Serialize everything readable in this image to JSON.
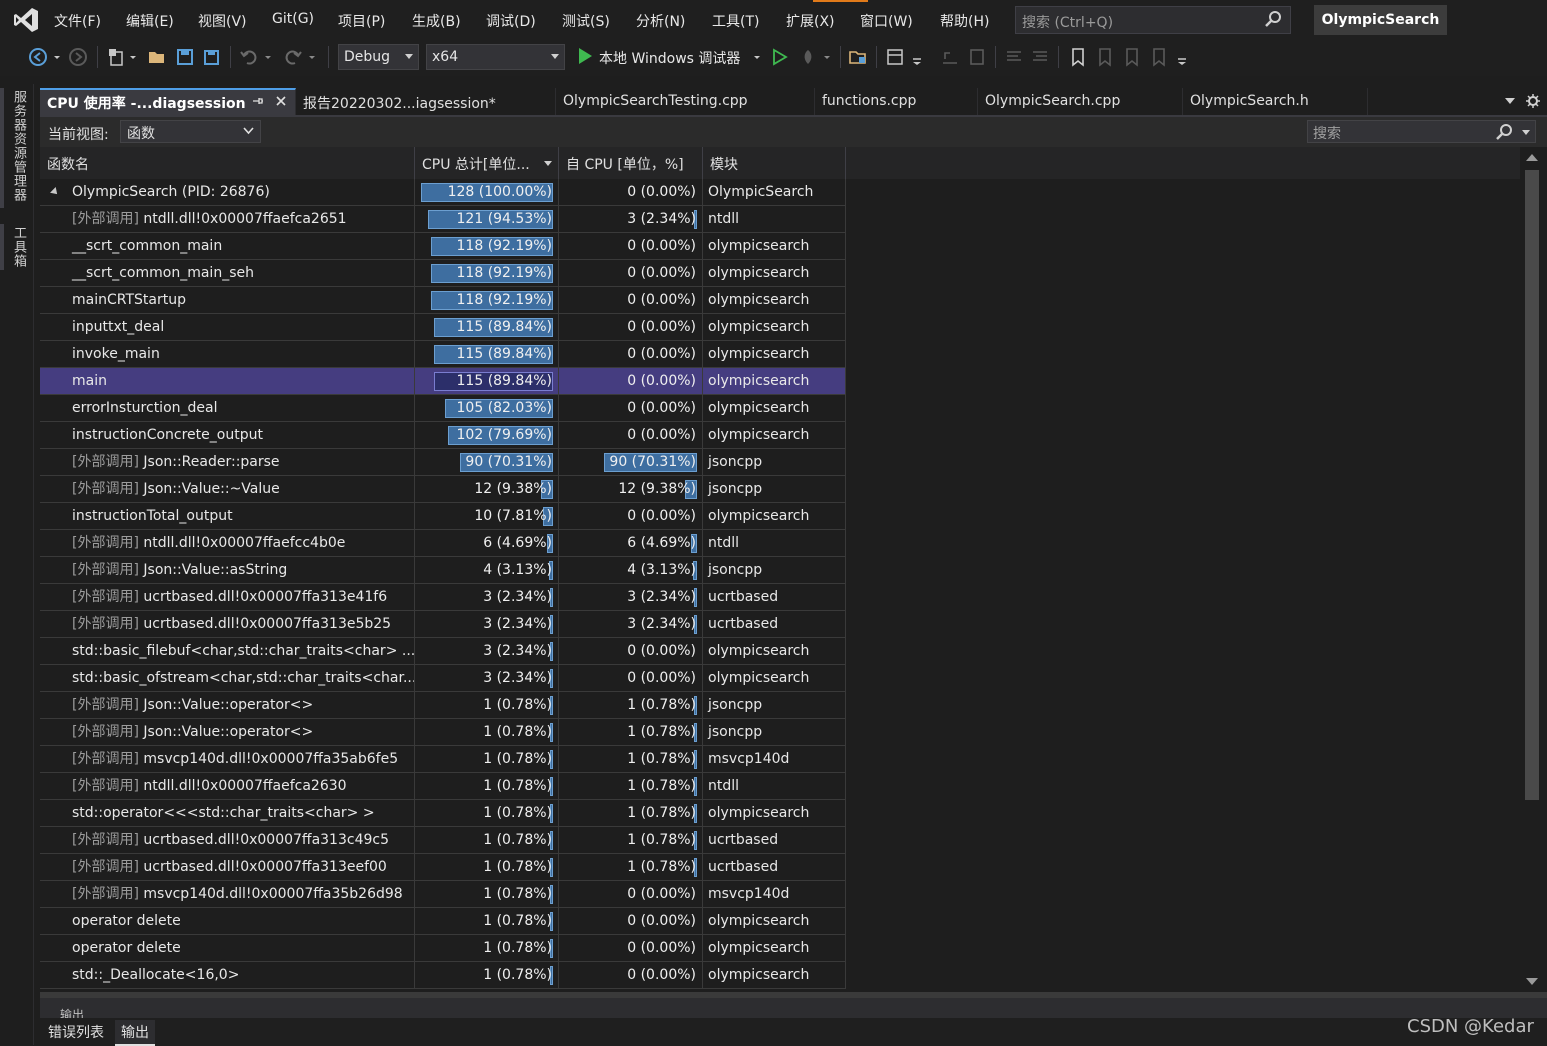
{
  "app": {
    "solution_name": "OlympicSearch"
  },
  "menu": [
    {
      "label": "文件(F)"
    },
    {
      "label": "编辑(E)"
    },
    {
      "label": "视图(V)"
    },
    {
      "label": "Git(G)"
    },
    {
      "label": "项目(P)"
    },
    {
      "label": "生成(B)"
    },
    {
      "label": "调试(D)"
    },
    {
      "label": "测试(S)"
    },
    {
      "label": "分析(N)"
    },
    {
      "label": "工具(T)"
    },
    {
      "label": "扩展(X)"
    },
    {
      "label": "窗口(W)"
    },
    {
      "label": "帮助(H)"
    }
  ],
  "search": {
    "placeholder": "搜索 (Ctrl+Q)"
  },
  "toolbar": {
    "config": "Debug",
    "platform": "x64",
    "run_label": "本地 Windows 调试器"
  },
  "left_strip": {
    "server_explorer": "服务器资源管理器",
    "toolbox": "工具箱"
  },
  "tabs": [
    {
      "label": "CPU 使用率 -...diagsession"
    },
    {
      "label": "报告20220302...iagsession*"
    },
    {
      "label": "OlympicSearchTesting.cpp"
    },
    {
      "label": "functions.cpp"
    },
    {
      "label": "OlympicSearch.cpp"
    },
    {
      "label": "OlympicSearch.h"
    }
  ],
  "view": {
    "label": "当前视图:",
    "value": "函数",
    "search_placeholder": "搜索"
  },
  "table": {
    "headers": {
      "name": "函数名",
      "total": "CPU 总计[单位...",
      "self": "自 CPU [单位，%]",
      "module": "模块"
    },
    "ext_prefix": "[外部调用]",
    "rows": [
      {
        "name": "OlympicSearch (PID: 26876)",
        "ext": false,
        "root": true,
        "total": "128 (100.00%)",
        "total_pct": 100.0,
        "self": "0 (0.00%)",
        "self_pct": 0.0,
        "module": "OlympicSearch"
      },
      {
        "name": "ntdll.dll!0x00007ffaefca2651",
        "ext": true,
        "total": "121 (94.53%)",
        "total_pct": 94.53,
        "self": "3 (2.34%)",
        "self_pct": 2.34,
        "module": "ntdll"
      },
      {
        "name": "__scrt_common_main",
        "ext": false,
        "total": "118 (92.19%)",
        "total_pct": 92.19,
        "self": "0 (0.00%)",
        "self_pct": 0.0,
        "module": "olympicsearch"
      },
      {
        "name": "__scrt_common_main_seh",
        "ext": false,
        "total": "118 (92.19%)",
        "total_pct": 92.19,
        "self": "0 (0.00%)",
        "self_pct": 0.0,
        "module": "olympicsearch"
      },
      {
        "name": "mainCRTStartup",
        "ext": false,
        "total": "118 (92.19%)",
        "total_pct": 92.19,
        "self": "0 (0.00%)",
        "self_pct": 0.0,
        "module": "olympicsearch"
      },
      {
        "name": "inputtxt_deal",
        "ext": false,
        "total": "115 (89.84%)",
        "total_pct": 89.84,
        "self": "0 (0.00%)",
        "self_pct": 0.0,
        "module": "olympicsearch"
      },
      {
        "name": "invoke_main",
        "ext": false,
        "total": "115 (89.84%)",
        "total_pct": 89.84,
        "self": "0 (0.00%)",
        "self_pct": 0.0,
        "module": "olympicsearch"
      },
      {
        "name": "main",
        "ext": false,
        "selected": true,
        "total": "115 (89.84%)",
        "total_pct": 89.84,
        "self": "0 (0.00%)",
        "self_pct": 0.0,
        "module": "olympicsearch"
      },
      {
        "name": "errorInsturction_deal",
        "ext": false,
        "total": "105 (82.03%)",
        "total_pct": 82.03,
        "self": "0 (0.00%)",
        "self_pct": 0.0,
        "module": "olympicsearch"
      },
      {
        "name": "instructionConcrete_output",
        "ext": false,
        "total": "102 (79.69%)",
        "total_pct": 79.69,
        "self": "0 (0.00%)",
        "self_pct": 0.0,
        "module": "olympicsearch"
      },
      {
        "name": "Json::Reader::parse",
        "ext": true,
        "total": "90 (70.31%)",
        "total_pct": 70.31,
        "self": "90 (70.31%)",
        "self_pct": 70.31,
        "module": "jsoncpp"
      },
      {
        "name": "Json::Value::~Value",
        "ext": true,
        "total": "12 (9.38%)",
        "total_pct": 9.38,
        "self": "12 (9.38%)",
        "self_pct": 9.38,
        "module": "jsoncpp"
      },
      {
        "name": "instructionTotal_output",
        "ext": false,
        "total": "10 (7.81%)",
        "total_pct": 7.81,
        "self": "0 (0.00%)",
        "self_pct": 0.0,
        "module": "olympicsearch"
      },
      {
        "name": "ntdll.dll!0x00007ffaefcc4b0e",
        "ext": true,
        "total": "6 (4.69%)",
        "total_pct": 4.69,
        "self": "6 (4.69%)",
        "self_pct": 4.69,
        "module": "ntdll"
      },
      {
        "name": "Json::Value::asString",
        "ext": true,
        "total": "4 (3.13%)",
        "total_pct": 3.13,
        "self": "4 (3.13%)",
        "self_pct": 3.13,
        "module": "jsoncpp"
      },
      {
        "name": "ucrtbased.dll!0x00007ffa313e41f6",
        "ext": true,
        "total": "3 (2.34%)",
        "total_pct": 2.34,
        "self": "3 (2.34%)",
        "self_pct": 2.34,
        "module": "ucrtbased"
      },
      {
        "name": "ucrtbased.dll!0x00007ffa313e5b25",
        "ext": true,
        "total": "3 (2.34%)",
        "total_pct": 2.34,
        "self": "3 (2.34%)",
        "self_pct": 2.34,
        "module": "ucrtbased"
      },
      {
        "name": "std::basic_filebuf<char,std::char_traits<char> ...",
        "ext": false,
        "total": "3 (2.34%)",
        "total_pct": 2.34,
        "self": "0 (0.00%)",
        "self_pct": 0.0,
        "module": "olympicsearch"
      },
      {
        "name": "std::basic_ofstream<char,std::char_traits<char...",
        "ext": false,
        "total": "3 (2.34%)",
        "total_pct": 2.34,
        "self": "0 (0.00%)",
        "self_pct": 0.0,
        "module": "olympicsearch"
      },
      {
        "name": "Json::Value::operator<>",
        "ext": true,
        "total": "1 (0.78%)",
        "total_pct": 0.78,
        "self": "1 (0.78%)",
        "self_pct": 0.78,
        "module": "jsoncpp"
      },
      {
        "name": "Json::Value::operator<>",
        "ext": true,
        "total": "1 (0.78%)",
        "total_pct": 0.78,
        "self": "1 (0.78%)",
        "self_pct": 0.78,
        "module": "jsoncpp"
      },
      {
        "name": "msvcp140d.dll!0x00007ffa35ab6fe5",
        "ext": true,
        "total": "1 (0.78%)",
        "total_pct": 0.78,
        "self": "1 (0.78%)",
        "self_pct": 0.78,
        "module": "msvcp140d"
      },
      {
        "name": "ntdll.dll!0x00007ffaefca2630",
        "ext": true,
        "total": "1 (0.78%)",
        "total_pct": 0.78,
        "self": "1 (0.78%)",
        "self_pct": 0.78,
        "module": "ntdll"
      },
      {
        "name": "std::operator<<<std::char_traits<char> >",
        "ext": false,
        "total": "1 (0.78%)",
        "total_pct": 0.78,
        "self": "1 (0.78%)",
        "self_pct": 0.78,
        "module": "olympicsearch"
      },
      {
        "name": "ucrtbased.dll!0x00007ffa313c49c5",
        "ext": true,
        "total": "1 (0.78%)",
        "total_pct": 0.78,
        "self": "1 (0.78%)",
        "self_pct": 0.78,
        "module": "ucrtbased"
      },
      {
        "name": "ucrtbased.dll!0x00007ffa313eef00",
        "ext": true,
        "total": "1 (0.78%)",
        "total_pct": 0.78,
        "self": "1 (0.78%)",
        "self_pct": 0.78,
        "module": "ucrtbased"
      },
      {
        "name": "msvcp140d.dll!0x00007ffa35b26d98",
        "ext": true,
        "total": "1 (0.78%)",
        "total_pct": 0.78,
        "self": "0 (0.00%)",
        "self_pct": 0.0,
        "module": "msvcp140d"
      },
      {
        "name": "operator delete",
        "ext": false,
        "total": "1 (0.78%)",
        "total_pct": 0.78,
        "self": "0 (0.00%)",
        "self_pct": 0.0,
        "module": "olympicsearch"
      },
      {
        "name": "operator delete",
        "ext": false,
        "total": "1 (0.78%)",
        "total_pct": 0.78,
        "self": "0 (0.00%)",
        "self_pct": 0.0,
        "module": "olympicsearch"
      },
      {
        "name": "std::_Deallocate<16,0>",
        "ext": false,
        "total": "1 (0.78%)",
        "total_pct": 0.78,
        "self": "0 (0.00%)",
        "self_pct": 0.0,
        "module": "olympicsearch"
      }
    ]
  },
  "bottom": {
    "output_title": "输出",
    "tabs": [
      {
        "label": "错误列表"
      },
      {
        "label": "输出"
      }
    ]
  },
  "watermark": "CSDN @Kedar",
  "colors": {
    "accent": "#4f9fe8",
    "selection": "#453d80",
    "bar": "#3e6ea0"
  }
}
